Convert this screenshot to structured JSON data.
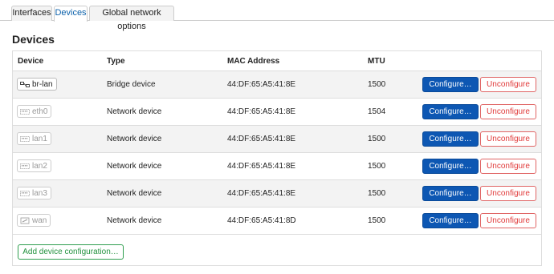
{
  "tabs": [
    {
      "label": "Interfaces",
      "active": false
    },
    {
      "label": "Devices",
      "active": true
    },
    {
      "label": "Global network options",
      "active": false
    }
  ],
  "page_title": "Devices",
  "table": {
    "headers": [
      "Device",
      "Type",
      "MAC Address",
      "MTU"
    ],
    "rows": [
      {
        "device": "br-lan",
        "icon": "bridge-icon",
        "muted": false,
        "type": "Bridge device",
        "mac": "44:DF:65:A5:41:8E",
        "mtu": "1500"
      },
      {
        "device": "eth0",
        "icon": "ethernet-port-icon",
        "muted": true,
        "type": "Network device",
        "mac": "44:DF:65:A5:41:8E",
        "mtu": "1504"
      },
      {
        "device": "lan1",
        "icon": "ethernet-port-icon",
        "muted": true,
        "type": "Network device",
        "mac": "44:DF:65:A5:41:8E",
        "mtu": "1500"
      },
      {
        "device": "lan2",
        "icon": "ethernet-port-icon",
        "muted": true,
        "type": "Network device",
        "mac": "44:DF:65:A5:41:8E",
        "mtu": "1500"
      },
      {
        "device": "lan3",
        "icon": "ethernet-port-icon",
        "muted": true,
        "type": "Network device",
        "mac": "44:DF:65:A5:41:8E",
        "mtu": "1500"
      },
      {
        "device": "wan",
        "icon": "wan-port-icon",
        "muted": true,
        "type": "Network device",
        "mac": "44:DF:65:A5:41:8D",
        "mtu": "1500"
      }
    ],
    "configure_label": "Configure…",
    "unconfigure_label": "Unconfigure"
  },
  "add_button_label": "Add device configuration…",
  "colors": {
    "active_tab_text": "#0d62ab",
    "configure_bg": "#0d57b3",
    "unconfigure_text": "#e03a3a",
    "add_button_text": "#23923f"
  }
}
